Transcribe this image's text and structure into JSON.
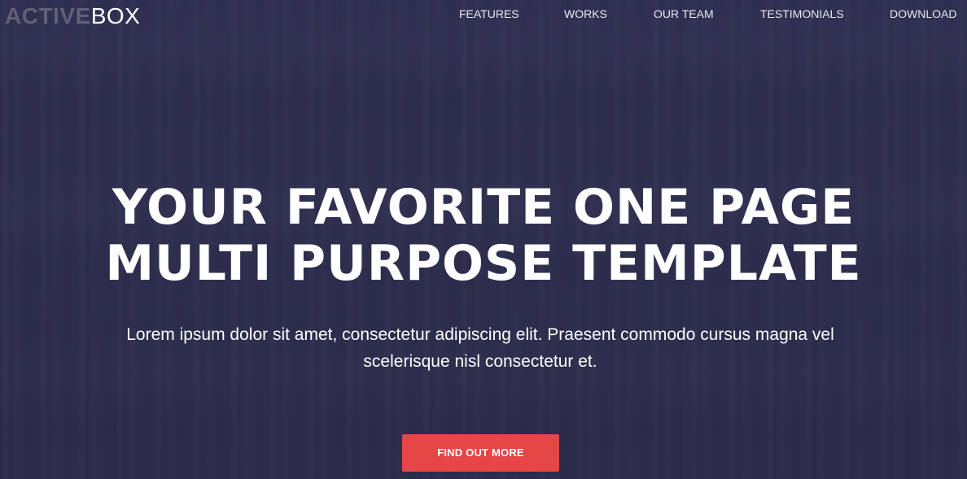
{
  "brand": {
    "strong": "ACTIVE",
    "light": "BOX"
  },
  "nav": {
    "items": [
      {
        "label": "FEATURES"
      },
      {
        "label": "WORKS"
      },
      {
        "label": "OUR TEAM"
      },
      {
        "label": "TESTIMONIALS"
      },
      {
        "label": "DOWNLOAD"
      }
    ]
  },
  "hero": {
    "headline_line1": "YOUR FAVORITE ONE PAGE",
    "headline_line2": "MULTI PURPOSE TEMPLATE",
    "subtext_line1": "Lorem ipsum dolor sit amet, consectetur adipiscing elit. Praesent commodo cursus magna vel",
    "subtext_line2": "scelerisque nisl consectetur et.",
    "cta_label": "FIND OUT MORE"
  },
  "colors": {
    "background": "#2f3050",
    "cta": "#e64646",
    "logo_strong": "#5f6177",
    "text": "#ffffff"
  }
}
